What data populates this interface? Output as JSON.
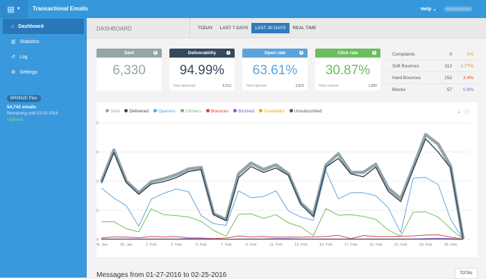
{
  "app": {
    "title": "Transactional Emails",
    "help": "Help"
  },
  "sidebar": {
    "items": [
      {
        "label": "Dashboard",
        "icon": "dashboard-icon"
      },
      {
        "label": "Statistics",
        "icon": "bar-chart-icon"
      },
      {
        "label": "Log",
        "icon": "undo-icon"
      },
      {
        "label": "Settings",
        "icon": "gear-icon"
      }
    ],
    "plan": {
      "badge": "BRONZE Plan",
      "emails": "54,742 emails",
      "remaining": "Remaining until 03-02-2016",
      "upgrade": "Upgrade"
    }
  },
  "header": {
    "title": "DASHBOARD",
    "ranges": [
      "TODAY",
      "LAST 7 DAYS",
      "LAST 30 DAYS",
      "REAL TIME"
    ],
    "active_range": "LAST 30 DAYS"
  },
  "cards": [
    {
      "title": "Sent",
      "value": "6,330",
      "color": "#95a5a6",
      "value_color": "#95a5a6"
    },
    {
      "title": "Deliverability",
      "value": "94.99%",
      "footer_label": "Total delivered",
      "footer_value": "6,013",
      "color": "#34495e",
      "value_color": "#34495e"
    },
    {
      "title": "Open rate",
      "value": "63.61%",
      "footer_label": "Total openers",
      "footer_value": "3,825",
      "color": "#5da3d9",
      "value_color": "#5da3d9"
    },
    {
      "title": "Click rate",
      "value": "30.87%",
      "footer_label": "Total clickers",
      "footer_value": "1,856",
      "color": "#6cbd5f",
      "value_color": "#6cbd5f"
    }
  ],
  "stats": [
    {
      "label": "Complaints",
      "count": "0",
      "pct": "0%",
      "color": "#f0a30a"
    },
    {
      "label": "Soft Bounces",
      "count": "112",
      "pct": "1.77%",
      "color": "#e67e22"
    },
    {
      "label": "Hard Bounces",
      "count": "152",
      "pct": "2.4%",
      "color": "#d9412f"
    },
    {
      "label": "Blocks",
      "count": "57",
      "pct": "0.9%",
      "color": "#7a5fc8"
    }
  ],
  "chart_data": {
    "type": "line",
    "x": [
      "28. Jan",
      "29. Jan",
      "30. Jan",
      "31. Jan",
      "1. Feb",
      "2. Feb",
      "3. Feb",
      "4. Feb",
      "5. Feb",
      "6. Feb",
      "7. Feb",
      "8. Feb",
      "9. Feb",
      "10. Feb",
      "11. Feb",
      "12. Feb",
      "13. Feb",
      "14. Feb",
      "15. Feb",
      "16. Feb",
      "17. Feb",
      "18. Feb",
      "19. Feb",
      "20. Feb",
      "21. Feb",
      "22. Feb",
      "23. Feb",
      "24. Feb",
      "25. Feb",
      "26. Feb"
    ],
    "x_tick_labels": [
      "28. Jan",
      "30. Jan",
      "1. Feb",
      "3. Feb",
      "5. Feb",
      "7. Feb",
      "9. Feb",
      "11. Feb",
      "13. Feb",
      "15. Feb",
      "17. Feb",
      "19. Feb",
      "21. Feb",
      "23. Feb",
      "25. Feb"
    ],
    "y_ticks": [
      "0",
      "100",
      "200",
      "300",
      "400"
    ],
    "ylim": [
      0,
      400
    ],
    "grid": true,
    "legend": "top-left",
    "series": [
      {
        "name": "Sent",
        "color": "#95a5a6",
        "values": [
          198,
          307,
          200,
          160,
          198,
          208,
          222,
          242,
          247,
          88,
          68,
          225,
          262,
          240,
          256,
          225,
          125,
          85,
          255,
          294,
          230,
          230,
          258,
          176,
          140,
          248,
          360,
          327,
          252,
          2
        ]
      },
      {
        "name": "Delivered",
        "color": "#34495e",
        "values": [
          193,
          298,
          195,
          155,
          190,
          198,
          212,
          233,
          240,
          85,
          64,
          212,
          250,
          230,
          245,
          220,
          120,
          78,
          248,
          278,
          225,
          215,
          248,
          165,
          130,
          240,
          345,
          300,
          245,
          2
        ]
      },
      {
        "name": "Openers",
        "color": "#5da3d9",
        "values": [
          177,
          142,
          116,
          45,
          138,
          158,
          173,
          163,
          82,
          54,
          48,
          167,
          143,
          147,
          167,
          98,
          77,
          65,
          236,
          139,
          160,
          160,
          150,
          109,
          23,
          210,
          213,
          188,
          69,
          0
        ]
      },
      {
        "name": "Clickers",
        "color": "#6cbd5f",
        "values": [
          60,
          61,
          37,
          26,
          105,
          85,
          82,
          77,
          62,
          31,
          11,
          86,
          88,
          72,
          85,
          57,
          43,
          13,
          106,
          83,
          85,
          79,
          69,
          32,
          11,
          93,
          95,
          77,
          37,
          0
        ]
      },
      {
        "name": "Bounces",
        "color": "#d9412f",
        "values": [
          5,
          9,
          8,
          6,
          10,
          9,
          10,
          5,
          5,
          3,
          5,
          12,
          9,
          10,
          8,
          8,
          8,
          9,
          10,
          14,
          3,
          13,
          10,
          10,
          11,
          12,
          15,
          16,
          8,
          1
        ]
      },
      {
        "name": "Blocked",
        "color": "#7a5fc8",
        "values": [
          2,
          2,
          2,
          2,
          2,
          2,
          2,
          3,
          3,
          2,
          1,
          2,
          2,
          2,
          3,
          3,
          2,
          2,
          2,
          2,
          2,
          2,
          2,
          2,
          2,
          2,
          3,
          4,
          3,
          0
        ]
      },
      {
        "name": "Complaint",
        "color": "#f0a30a",
        "values": [
          0,
          0,
          0,
          0,
          0,
          0,
          0,
          0,
          0,
          0,
          0,
          0,
          0,
          0,
          0,
          0,
          0,
          0,
          0,
          0,
          0,
          0,
          0,
          0,
          0,
          0,
          0,
          0,
          0,
          0
        ]
      },
      {
        "name": "Unsubscribed",
        "color": "#555555",
        "values": [
          1,
          1,
          1,
          1,
          1,
          1,
          1,
          1,
          1,
          1,
          1,
          1,
          1,
          1,
          1,
          1,
          1,
          1,
          1,
          1,
          1,
          1,
          1,
          1,
          1,
          1,
          1,
          1,
          1,
          0
        ]
      }
    ]
  },
  "messages": {
    "title": "Messages from 01-27-2016 to 02-25-2016",
    "total_button": "TOTAL"
  }
}
